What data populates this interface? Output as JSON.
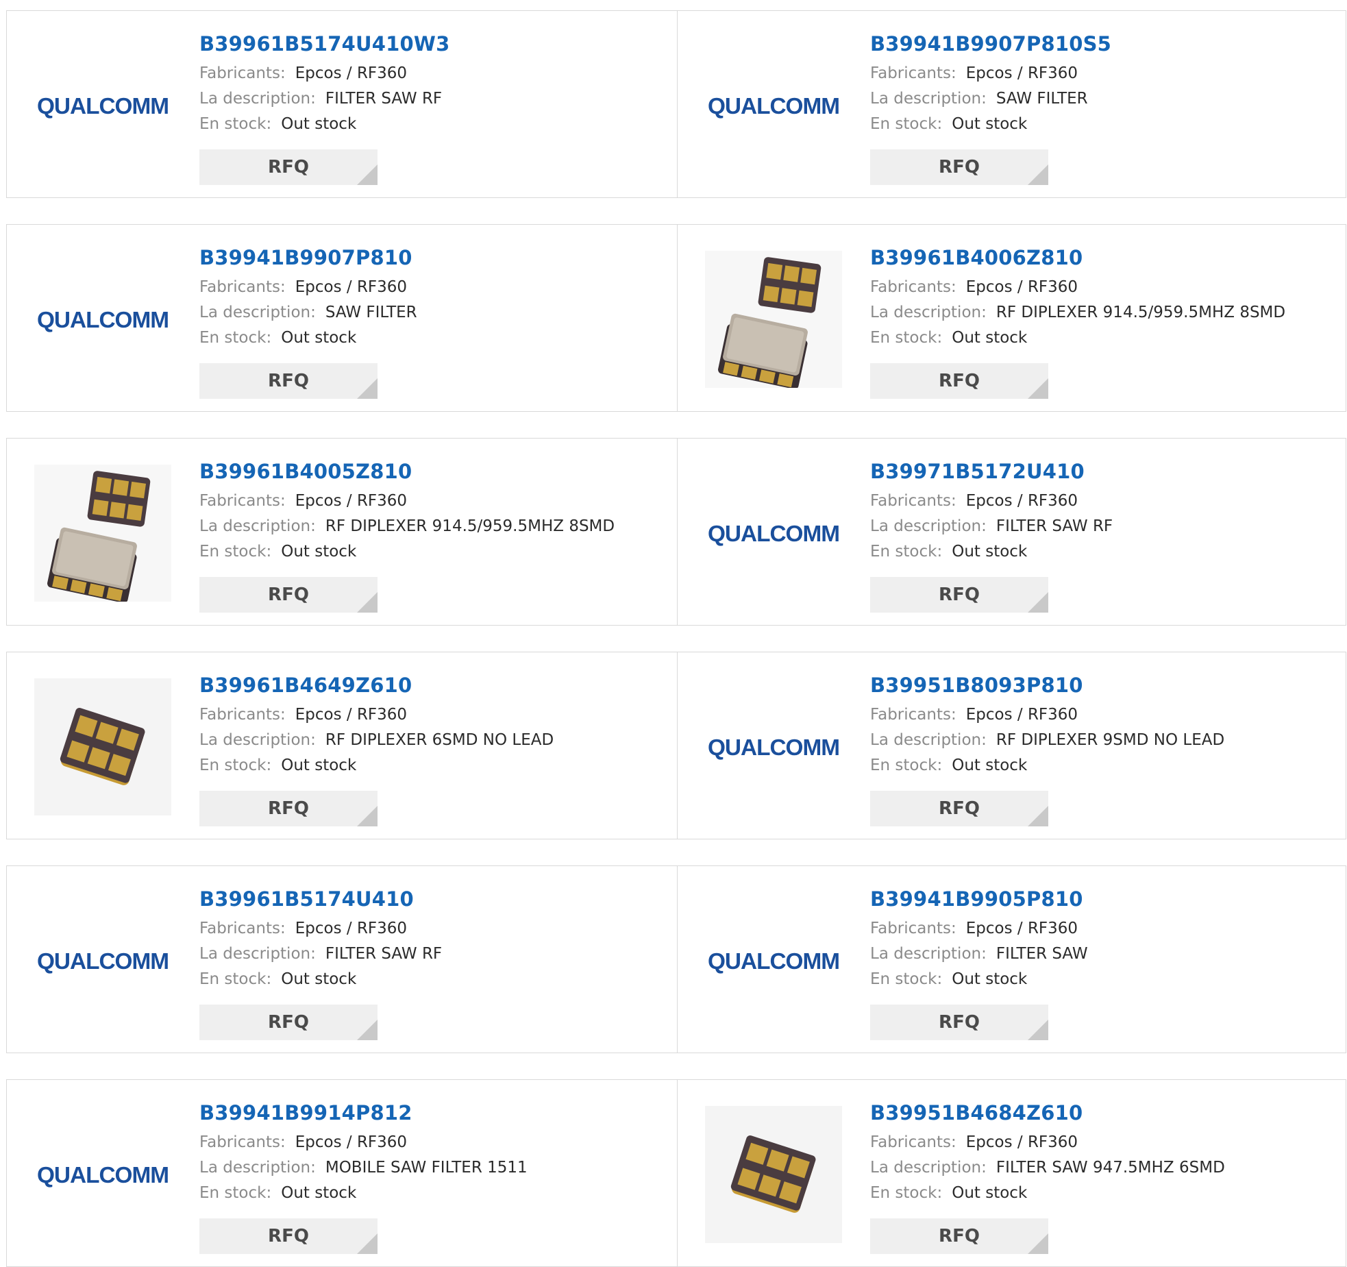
{
  "labels": {
    "manufacturer": "Fabricants:",
    "description": "La description:",
    "stock": "En stock:",
    "rfq": "RFQ"
  },
  "logo_text": "QUALCOMM",
  "products": [
    {
      "part": "B39961B5174U410W3",
      "manufacturer": "Epcos / RF360",
      "description": "FILTER SAW RF",
      "stock": "Out stock",
      "image": "qualcomm-logo"
    },
    {
      "part": "B39941B9907P810S5",
      "manufacturer": "Epcos / RF360",
      "description": "SAW FILTER",
      "stock": "Out stock",
      "image": "qualcomm-logo"
    },
    {
      "part": "B39941B9907P810",
      "manufacturer": "Epcos / RF360",
      "description": "SAW FILTER",
      "stock": "Out stock",
      "image": "qualcomm-logo"
    },
    {
      "part": "B39961B4006Z810",
      "manufacturer": "Epcos / RF360",
      "description": "RF DIPLEXER 914.5/959.5MHZ 8SMD",
      "stock": "Out stock",
      "image": "chip-pair-photo"
    },
    {
      "part": "B39961B4005Z810",
      "manufacturer": "Epcos / RF360",
      "description": "RF DIPLEXER 914.5/959.5MHZ 8SMD",
      "stock": "Out stock",
      "image": "chip-pair-photo"
    },
    {
      "part": "B39971B5172U410",
      "manufacturer": "Epcos / RF360",
      "description": "FILTER SAW RF",
      "stock": "Out stock",
      "image": "qualcomm-logo"
    },
    {
      "part": "B39961B4649Z610",
      "manufacturer": "Epcos / RF360",
      "description": "RF DIPLEXER 6SMD NO LEAD",
      "stock": "Out stock",
      "image": "chip-6pad-photo"
    },
    {
      "part": "B39951B8093P810",
      "manufacturer": "Epcos / RF360",
      "description": "RF DIPLEXER 9SMD NO LEAD",
      "stock": "Out stock",
      "image": "qualcomm-logo"
    },
    {
      "part": "B39961B5174U410",
      "manufacturer": "Epcos / RF360",
      "description": "FILTER SAW RF",
      "stock": "Out stock",
      "image": "qualcomm-logo"
    },
    {
      "part": "B39941B9905P810",
      "manufacturer": "Epcos / RF360",
      "description": "FILTER SAW",
      "stock": "Out stock",
      "image": "qualcomm-logo"
    },
    {
      "part": "B39941B9914P812",
      "manufacturer": "Epcos / RF360",
      "description": "MOBILE SAW FILTER 1511",
      "stock": "Out stock",
      "image": "qualcomm-logo"
    },
    {
      "part": "B39951B4684Z610",
      "manufacturer": "Epcos / RF360",
      "description": "FILTER SAW 947.5MHZ 6SMD",
      "stock": "Out stock",
      "image": "chip-6pad-photo"
    }
  ],
  "colors": {
    "part_link": "#1565b5",
    "logo_blue": "#1a4f9c",
    "button_bg": "#efefef",
    "border": "#d9d9d9"
  }
}
